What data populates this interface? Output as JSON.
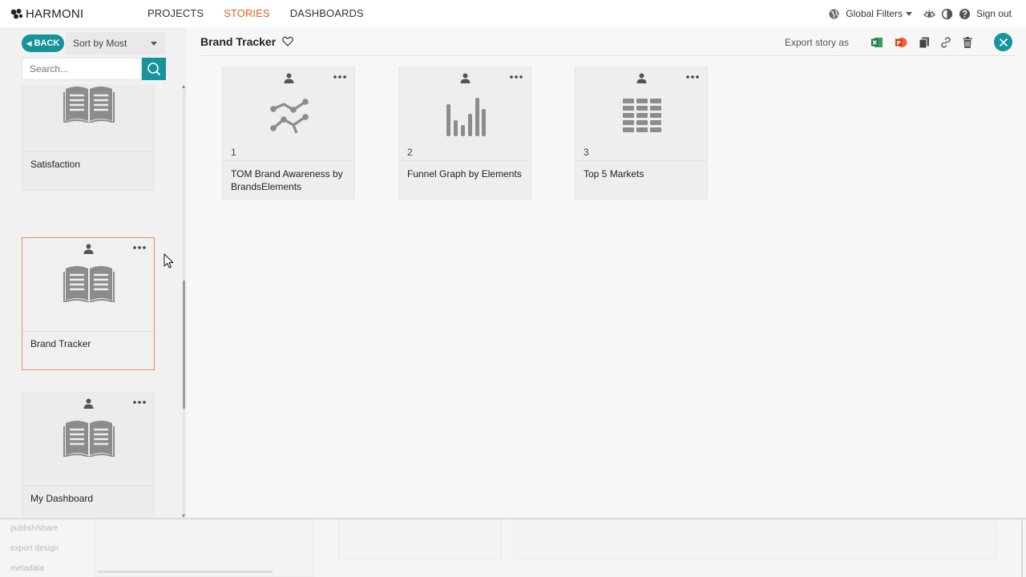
{
  "app": {
    "logo_text": "HARMONI"
  },
  "nav": {
    "items": [
      "PROJECTS",
      "STORIES",
      "DASHBOARDS"
    ],
    "active": "STORIES"
  },
  "top_right": {
    "global_filters_label": "Global Filters",
    "sign_out_label": "Sign out",
    "icons": [
      "globe-icon",
      "eye-icon",
      "contrast-icon",
      "help-icon"
    ]
  },
  "sidebar": {
    "back_label": "BACK",
    "sort_value": "Sort by Most",
    "search_placeholder": "Search...",
    "stories": [
      {
        "name": "Satisfaction",
        "selected": false
      },
      {
        "name": "Brand Tracker",
        "selected": true
      },
      {
        "name": "My Dashboard",
        "selected": false
      }
    ]
  },
  "main": {
    "story_title": "Brand Tracker",
    "export_label": "Export story as",
    "action_icons": [
      "excel-icon",
      "powerpoint-icon",
      "copy-icon",
      "link-icon",
      "trash-icon"
    ],
    "charts": [
      {
        "number": "1",
        "name": "TOM Brand Awareness by BrandsElements",
        "icon": "line-chart-icon"
      },
      {
        "number": "2",
        "name": "Funnel Graph by Elements",
        "icon": "bar-chart-icon"
      },
      {
        "number": "3",
        "name": "Top 5 Markets",
        "icon": "table-icon"
      }
    ]
  },
  "background_layer": {
    "menu_items": [
      "publish/share",
      "export design",
      "metadata"
    ]
  },
  "colors": {
    "accent_teal": "#17939a",
    "active_orange": "#e2611a",
    "selected_border": "#f08a5d",
    "icon_gray": "#8c8c8c"
  }
}
